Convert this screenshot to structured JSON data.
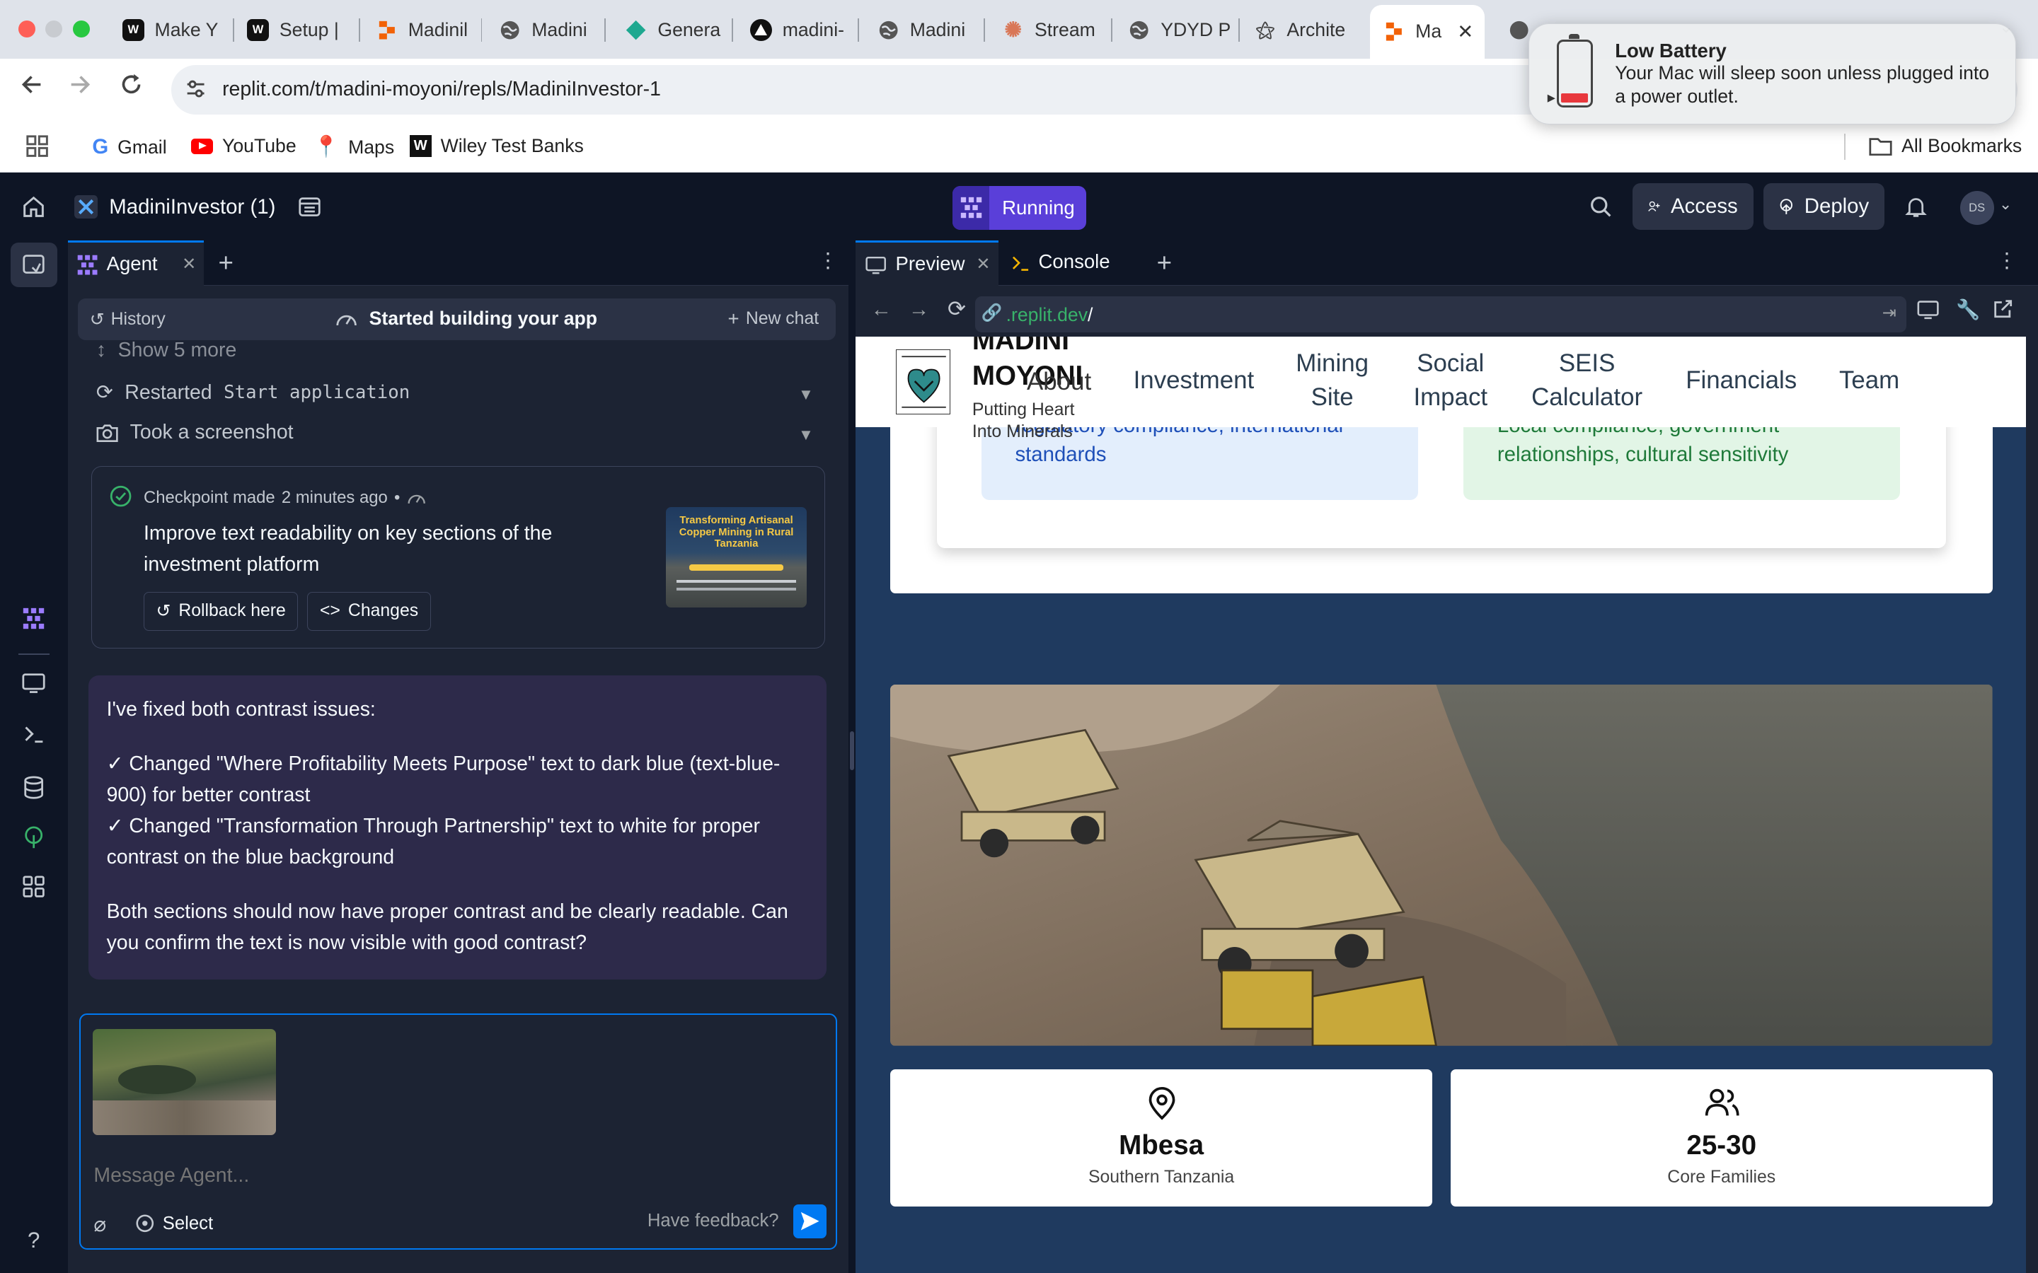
{
  "browser": {
    "tabs": [
      {
        "label": "Make Y",
        "icon": "wix-icon"
      },
      {
        "label": "Setup |",
        "icon": "wix-icon"
      },
      {
        "label": "Madinil",
        "icon": "replit-icon"
      },
      {
        "label": "Madini",
        "icon": "globe-icon"
      },
      {
        "label": "Genera",
        "icon": "diamond-icon"
      },
      {
        "label": "madini-",
        "icon": "vercel-icon"
      },
      {
        "label": "Madini",
        "icon": "globe-icon"
      },
      {
        "label": "Stream",
        "icon": "claude-icon"
      },
      {
        "label": "YDYD P",
        "icon": "globe-icon"
      },
      {
        "label": "Archite",
        "icon": "architect-icon"
      },
      {
        "label": "Ma",
        "icon": "replit-icon"
      }
    ],
    "address": "replit.com/t/madini-moyoni/repls/MadiniInvestor-1",
    "bookmarks": [
      "Gmail",
      "YouTube",
      "Maps",
      "Wiley Test Banks"
    ],
    "all_bookmarks": "All Bookmarks"
  },
  "notification": {
    "title": "Low Battery",
    "body": "Your Mac will sleep soon unless plugged into a power outlet."
  },
  "replit": {
    "project": "MadiniInvestor (1)",
    "status": "Running",
    "access": "Access",
    "deploy": "Deploy",
    "avatar": "DS"
  },
  "agent": {
    "tab": "Agent",
    "history": "History",
    "status": "Started building your app",
    "new_chat": "New chat",
    "show_more": "Show 5 more",
    "actions": [
      {
        "prefix": "Restarted",
        "code": "Start application"
      },
      {
        "prefix": "Took a screenshot",
        "code": ""
      }
    ],
    "checkpoint": {
      "label": "Checkpoint made",
      "time": "2 minutes ago",
      "description": "Improve text readability on key sections of the investment platform",
      "rollback": "Rollback here",
      "changes": "Changes",
      "thumb_title": "Transforming Artisanal Copper Mining in Rural Tanzania"
    },
    "message": {
      "intro": "I've fixed both contrast issues:",
      "items": [
        "✓ Changed \"Where Profitability Meets Purpose\" text to dark blue (text-blue-900) for better contrast",
        "✓ Changed \"Transformation Through Partnership\" text to white for proper contrast on the blue background"
      ],
      "outro": "Both sections should now have proper contrast and be clearly readable. Can you confirm the text is now visible with good contrast?"
    },
    "input": {
      "placeholder": "Message Agent...",
      "select": "Select",
      "feedback": "Have feedback?"
    }
  },
  "preview": {
    "tabs": [
      "Preview",
      "Console"
    ],
    "url_prefix": ".replit.dev",
    "url_suffix": "/",
    "site": {
      "brand": "MADINI MOYONI",
      "tagline": "Putting Heart Into Minerals",
      "nav": [
        "About",
        "Investment",
        "Mining Site",
        "Social Impact",
        "SEIS Calculator",
        "Financials",
        "Team"
      ],
      "card_left": "regulatory compliance, international standards",
      "card_right": "Local compliance, government relationships, cultural sensitivity",
      "stats": [
        {
          "value": "Mbesa",
          "label": "Southern Tanzania",
          "icon": "map-pin-icon"
        },
        {
          "value": "25-30",
          "label": "Core Families",
          "icon": "users-icon"
        }
      ]
    }
  }
}
